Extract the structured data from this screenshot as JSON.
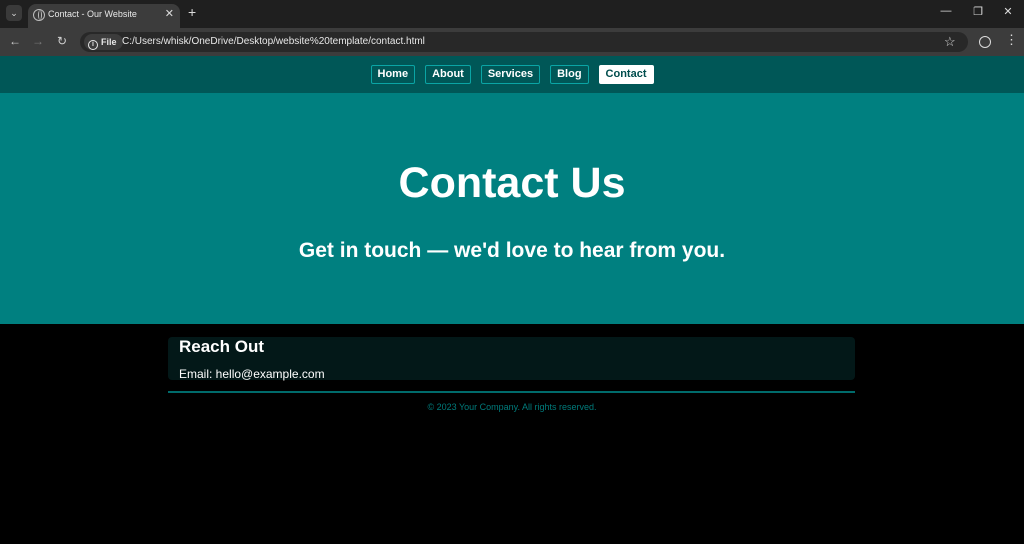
{
  "browser": {
    "tab_title": "Contact - Our Website",
    "new_tab_label": "+",
    "url_chip": "File",
    "url": "C:/Users/whisk/OneDrive/Desktop/website%20template/contact.html",
    "icons": [
      "tab-search-icon",
      "globe-icon",
      "close-icon",
      "back-icon",
      "forward-icon",
      "reload-icon",
      "info-icon",
      "star-icon",
      "profile-icon",
      "menu-icon"
    ]
  },
  "nav": {
    "items": [
      {
        "label": "Home"
      },
      {
        "label": "About"
      },
      {
        "label": "Services"
      },
      {
        "label": "Blog"
      },
      {
        "label": "Contact",
        "active": true
      }
    ]
  },
  "hero": {
    "title": "Contact Us",
    "subtitle": "Get in touch — we'd love to hear from you."
  },
  "contact_card": {
    "title": "Reach Out",
    "email_line": "Email: hello@example.com"
  },
  "footer": {
    "text": "© 2023 Your Company. All rights reserved."
  },
  "colors": {
    "nav_bg": "#005757",
    "hero_bg": "#008080",
    "page_bg": "#000000",
    "card_bg": "#031818",
    "accent": "#007b7b"
  }
}
